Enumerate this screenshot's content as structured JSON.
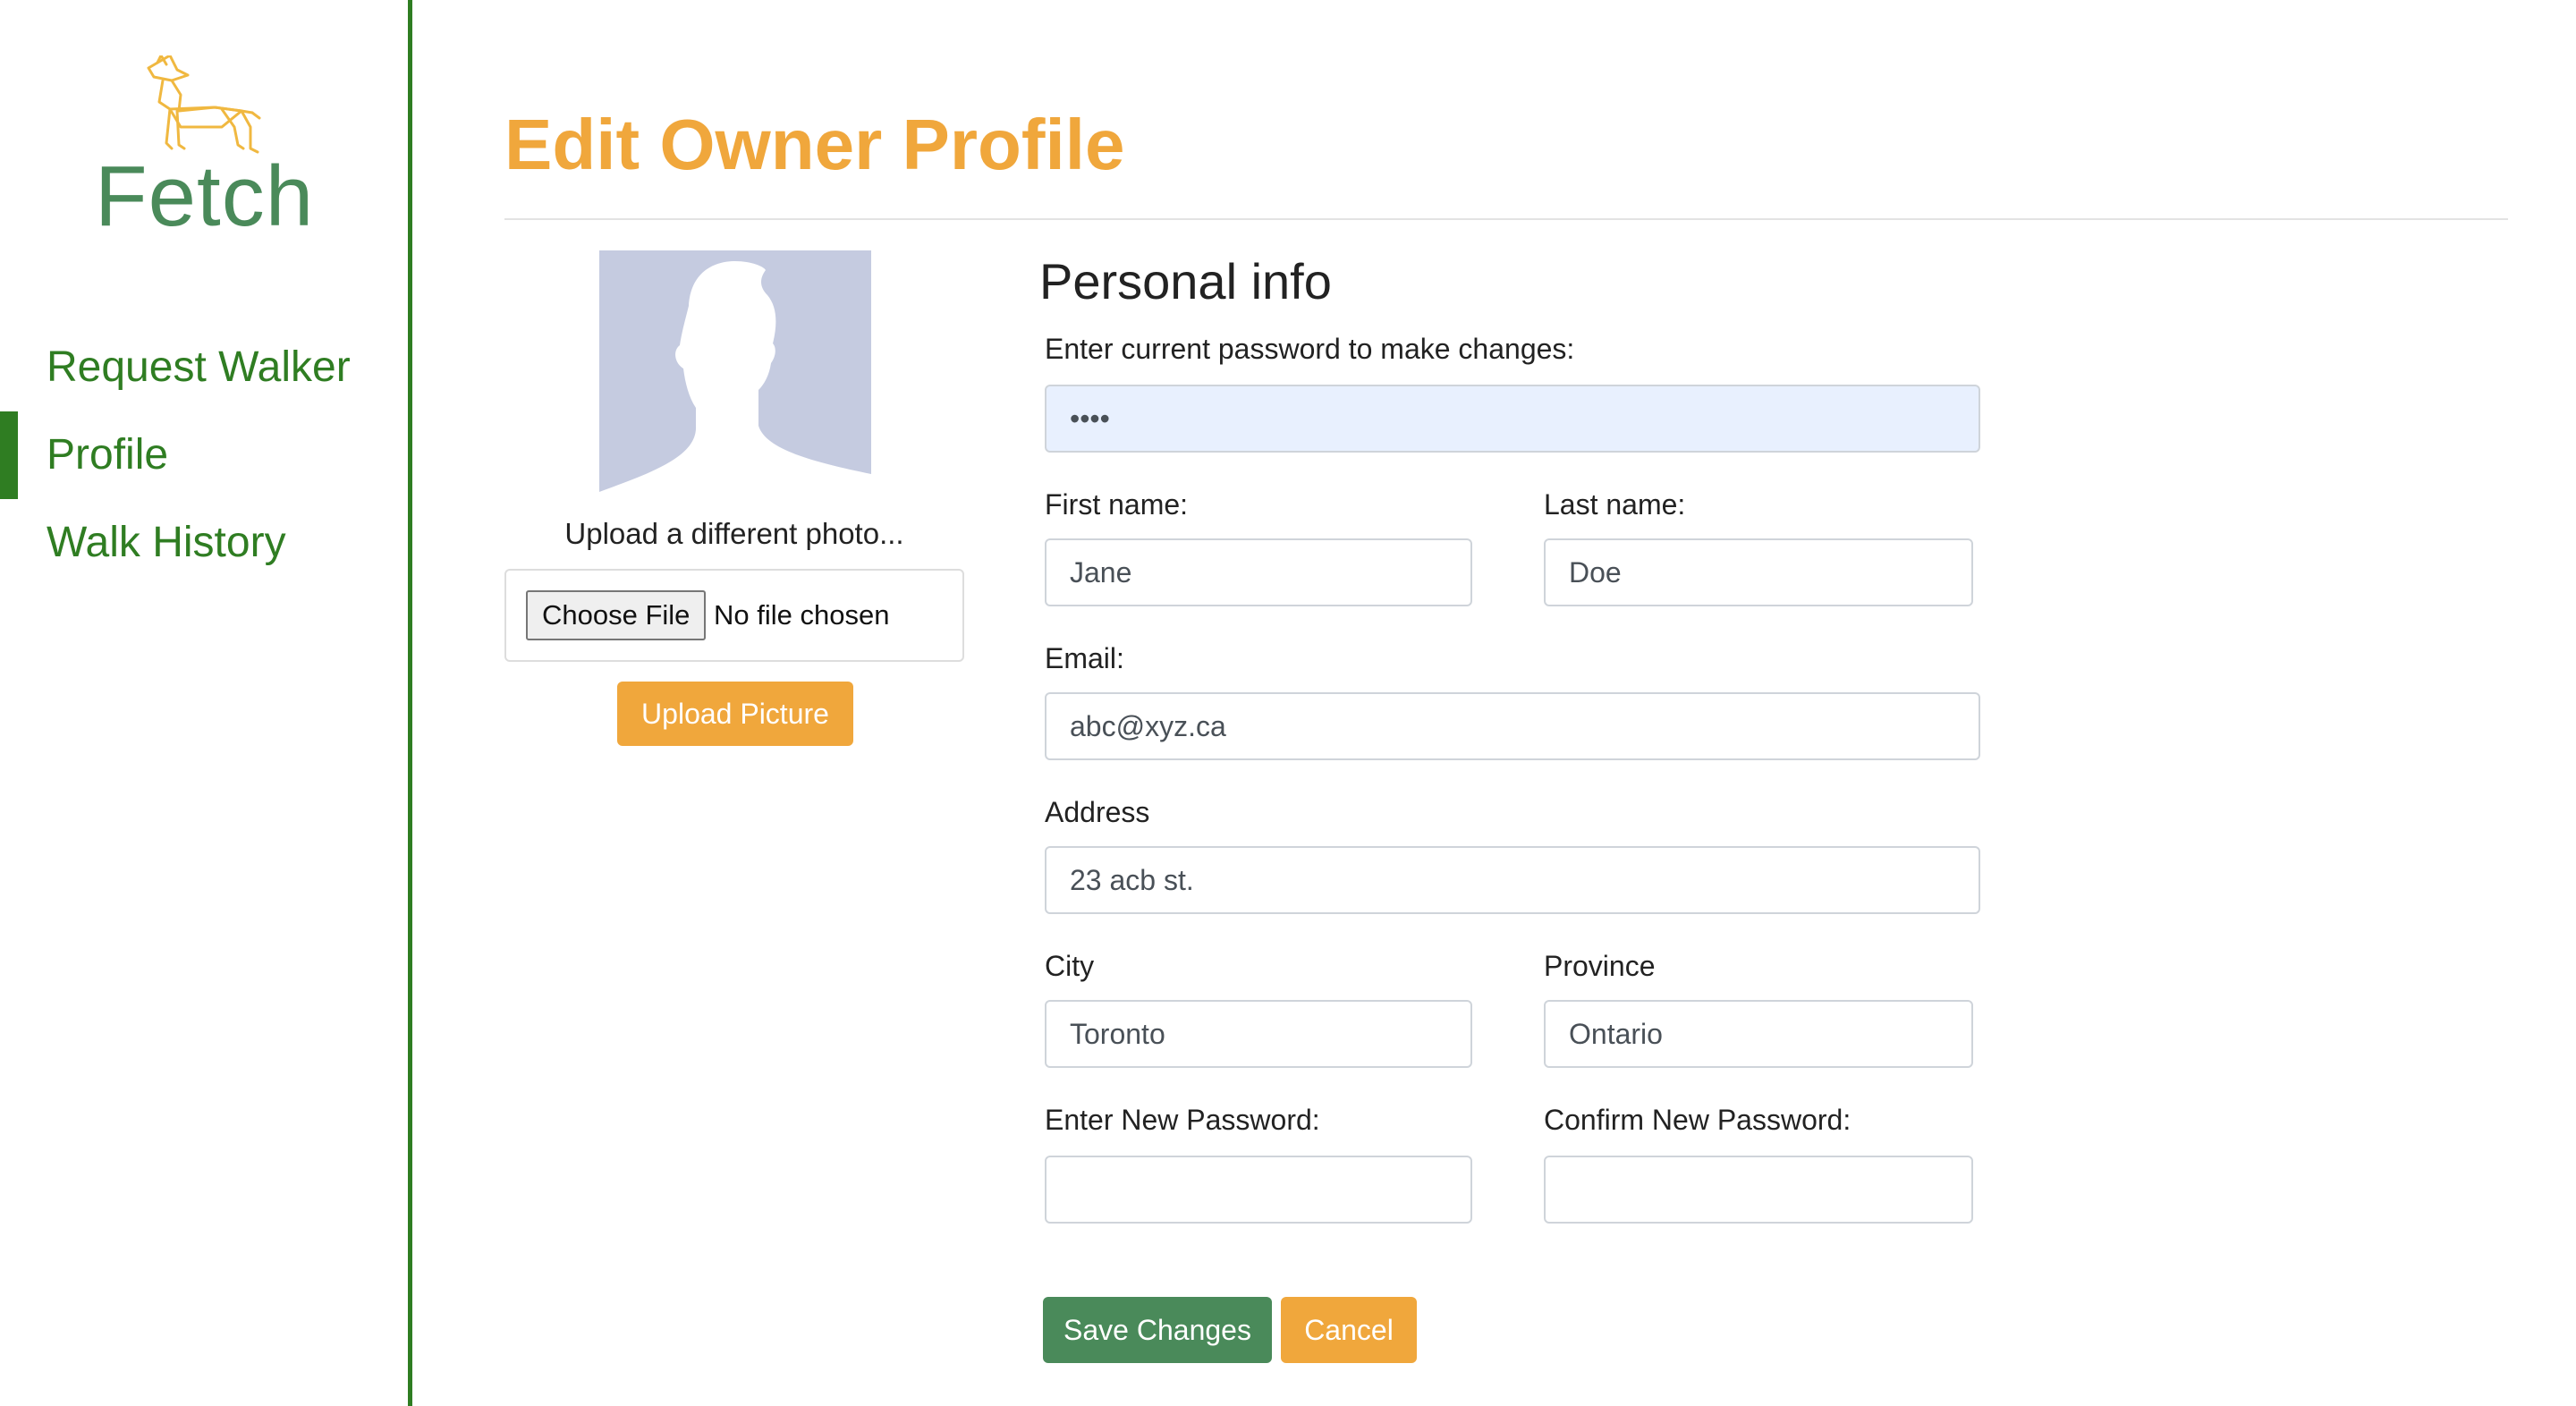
{
  "sidebar": {
    "logo_text": "Fetch",
    "items": [
      {
        "label": "Request Walker"
      },
      {
        "label": "Profile",
        "active": true
      },
      {
        "label": "Walk History"
      }
    ]
  },
  "page": {
    "title": "Edit Owner Profile"
  },
  "photo": {
    "upload_label": "Upload a different photo...",
    "choose_label": "Choose File",
    "no_file_text": "No file chosen",
    "upload_button": "Upload Picture"
  },
  "form": {
    "heading": "Personal info",
    "current_password": {
      "label": "Enter current password to make changes:",
      "value": "••••"
    },
    "first_name": {
      "label": "First name:",
      "value": "Jane"
    },
    "last_name": {
      "label": "Last name:",
      "value": "Doe"
    },
    "email": {
      "label": "Email:",
      "value": "abc@xyz.ca"
    },
    "address": {
      "label": "Address",
      "value": "23 acb st."
    },
    "city": {
      "label": "City",
      "value": "Toronto"
    },
    "province": {
      "label": "Province",
      "value": "Ontario"
    },
    "new_password": {
      "label": "Enter New Password:",
      "value": ""
    },
    "confirm_password": {
      "label": "Confirm New Password:",
      "value": ""
    },
    "save_label": "Save Changes",
    "cancel_label": "Cancel"
  },
  "colors": {
    "brand_green": "#2f7d22",
    "accent_orange": "#f0a73c",
    "save_green": "#4a8a5a",
    "autofill_blue": "#e8f0fe"
  },
  "icons": [
    "dog-logo-icon",
    "avatar-silhouette-icon"
  ]
}
